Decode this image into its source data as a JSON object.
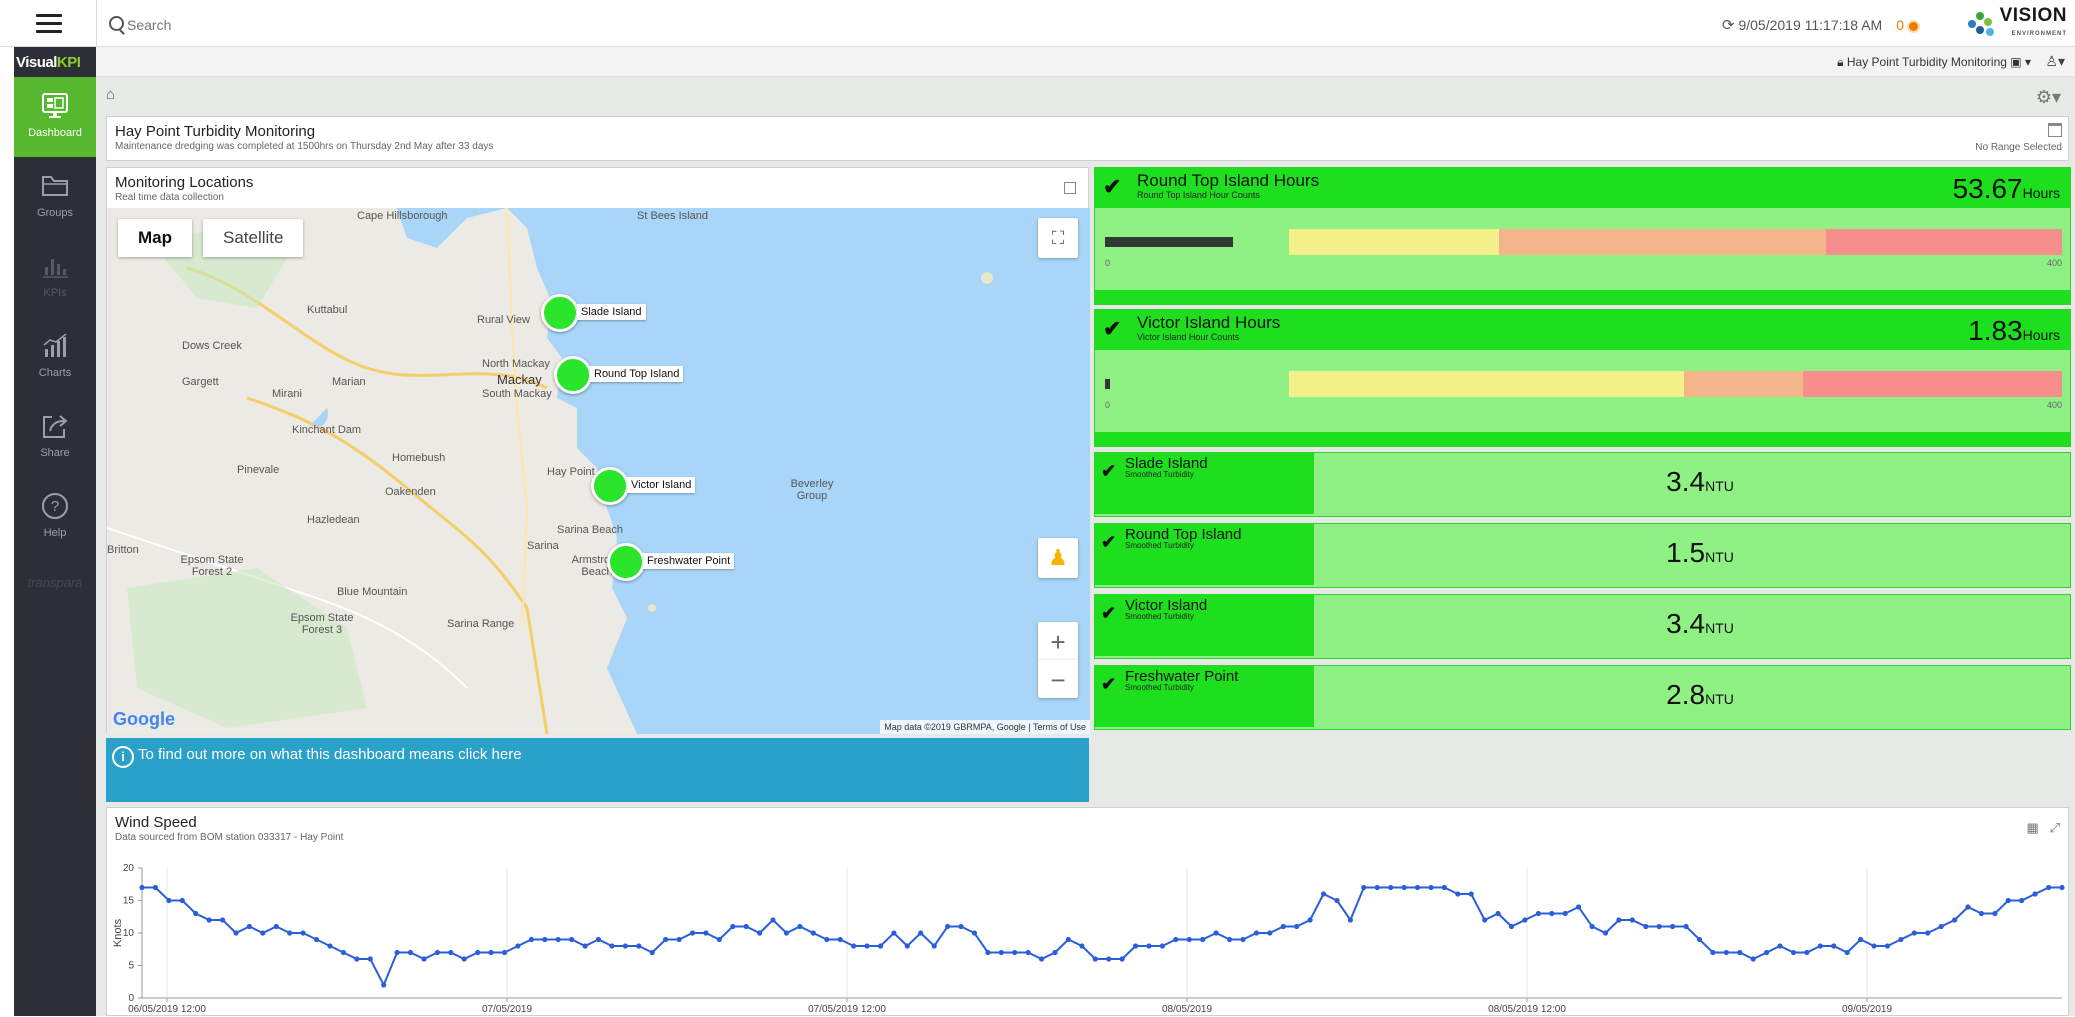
{
  "topbar": {
    "search_placeholder": "Search",
    "timestamp": "9/05/2019 11:17:18 AM",
    "alarm_count": "0",
    "brand": "VISION",
    "brand_sub": "ENVIRONMENT"
  },
  "subbar": {
    "dashboard_name": "Hay Point Turbidity Monitoring"
  },
  "sidebar": {
    "logo_left": "Visual",
    "logo_right": "KPI",
    "items": [
      {
        "label": "Dashboard",
        "icon": "dashboard-icon",
        "active": true
      },
      {
        "label": "Groups",
        "icon": "folder-icon"
      },
      {
        "label": "KPIs",
        "icon": "bar-chart-icon",
        "disabled": true
      },
      {
        "label": "Charts",
        "icon": "charts-icon"
      },
      {
        "label": "Share",
        "icon": "share-icon"
      },
      {
        "label": "Help",
        "icon": "help-icon"
      }
    ],
    "footer": "transpara"
  },
  "header": {
    "title": "Hay Point Turbidity Monitoring",
    "subtitle": "Maintenance dredging was completed at 1500hrs on Thursday 2nd May after 33 days",
    "range": "No Range Selected"
  },
  "map_panel": {
    "title": "Monitoring Locations",
    "subtitle": "Real time data collection",
    "map_button": "Map",
    "satellite_button": "Satellite",
    "markers": [
      "Slade Island",
      "Round Top Island",
      "Victor Island",
      "Freshwater Point"
    ],
    "towns": [
      "Cape Hillsborough",
      "St Bees Island",
      "Kuttabul",
      "Rural View",
      "Dows Creek",
      "North Mackay",
      "Mackay",
      "South Mackay",
      "Gargett",
      "Marian",
      "Mirani",
      "Kinchant Dam",
      "Homebush",
      "Pinevale",
      "Hay Point",
      "Oakenden",
      "Beverley Group",
      "Hazledean",
      "Sarina Beach",
      "Sarina",
      "Armstrong Beach",
      "Epsom State Forest 2",
      "Blue Mountain",
      "Epsom State Forest 3",
      "Sarina Range",
      "Britton"
    ],
    "attribution": "Map data ©2019 GBRMPA, Google",
    "terms": "Terms of Use",
    "google": "Google"
  },
  "info_banner": {
    "text": "To find out more on what this dashboard means click here"
  },
  "kpis_big": [
    {
      "title": "Round Top Island Hours",
      "subtitle": "Round Top Island Hour Counts",
      "value": "53.67",
      "unit": "Hours",
      "scale_min": "0",
      "scale_max": "400",
      "level_fraction": 0.134
    },
    {
      "title": "Victor Island Hours",
      "subtitle": "Victor Island Hour Counts",
      "value": "1.83",
      "unit": "Hours",
      "scale_min": "0",
      "scale_max": "400",
      "level_fraction": 0.005
    }
  ],
  "kpis_small": [
    {
      "title": "Slade Island",
      "subtitle": "Smoothed Turbidity",
      "value": "3.4",
      "unit": "NTU"
    },
    {
      "title": "Round Top Island",
      "subtitle": "Smoothed Turbidity",
      "value": "1.5",
      "unit": "NTU"
    },
    {
      "title": "Victor Island",
      "subtitle": "Smoothed Turbidity",
      "value": "3.4",
      "unit": "NTU"
    },
    {
      "title": "Freshwater Point",
      "subtitle": "Smoothed Turbidity",
      "value": "2.8",
      "unit": "NTU"
    }
  ],
  "wind_panel": {
    "title": "Wind Speed",
    "subtitle": "Data sourced from BOM station 033317 - Hay Point"
  },
  "chart_data": {
    "type": "line",
    "title": "Wind Speed",
    "ylabel": "Knots",
    "xlabel": "",
    "ylim": [
      0,
      20
    ],
    "yticks": [
      0,
      5,
      10,
      15,
      20
    ],
    "xticks": [
      "06/05/2019 12:00",
      "07/05/2019",
      "07/05/2019 12:00",
      "08/05/2019",
      "08/05/2019 12:00",
      "09/05/2019"
    ],
    "color": "#2b5fd9",
    "series": [
      {
        "values": [
          17,
          17,
          15,
          15,
          13,
          12,
          12,
          10,
          11,
          10,
          11,
          10,
          10,
          9,
          8,
          7,
          6,
          6,
          2,
          7,
          7,
          6,
          7,
          7,
          6,
          7,
          7,
          7,
          8,
          9,
          9,
          9,
          9,
          8,
          9,
          8,
          8,
          8,
          7,
          9,
          9,
          10,
          10,
          9,
          11,
          11,
          10,
          12,
          10,
          11,
          10,
          9,
          9,
          8,
          8,
          8,
          10,
          8,
          10,
          8,
          11,
          11,
          10,
          7,
          7,
          7,
          7,
          6,
          7,
          9,
          8,
          6,
          6,
          6,
          8,
          8,
          8,
          9,
          9,
          9,
          10,
          9,
          9,
          10,
          10,
          11,
          11,
          12,
          16,
          15,
          12,
          17,
          17,
          17,
          17,
          17,
          17,
          17,
          16,
          16,
          12,
          13,
          11,
          12,
          13,
          13,
          13,
          14,
          11,
          10,
          12,
          12,
          11,
          11,
          11,
          11,
          9,
          7,
          7,
          7,
          6,
          7,
          8,
          7,
          7,
          8,
          8,
          7,
          9,
          8,
          8,
          9,
          10,
          10,
          11,
          12,
          14,
          13,
          13,
          15,
          15,
          16,
          17,
          17
        ]
      }
    ]
  }
}
